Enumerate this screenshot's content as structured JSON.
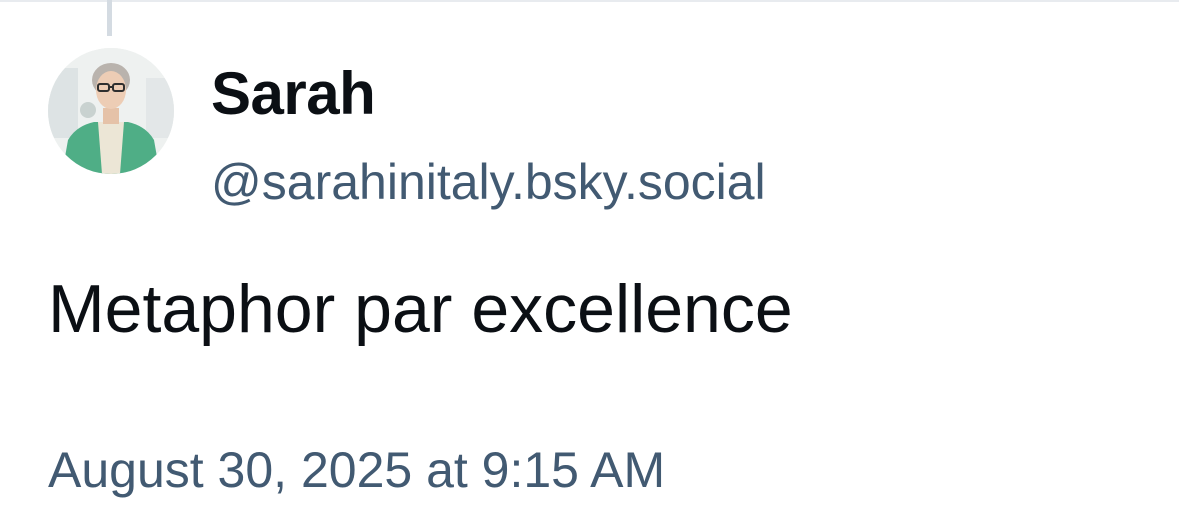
{
  "post": {
    "author": {
      "display_name": "Sarah",
      "handle": "@sarahinitaly.bsky.social",
      "avatar_icon": "user-avatar-photo"
    },
    "text": "Metaphor par excellence",
    "timestamp": "August 30, 2025 at 9:15 AM"
  },
  "colors": {
    "primary_text": "#0b0f14",
    "secondary_text": "#425a72",
    "thread_line": "#d4dbe2",
    "background": "#ffffff"
  }
}
